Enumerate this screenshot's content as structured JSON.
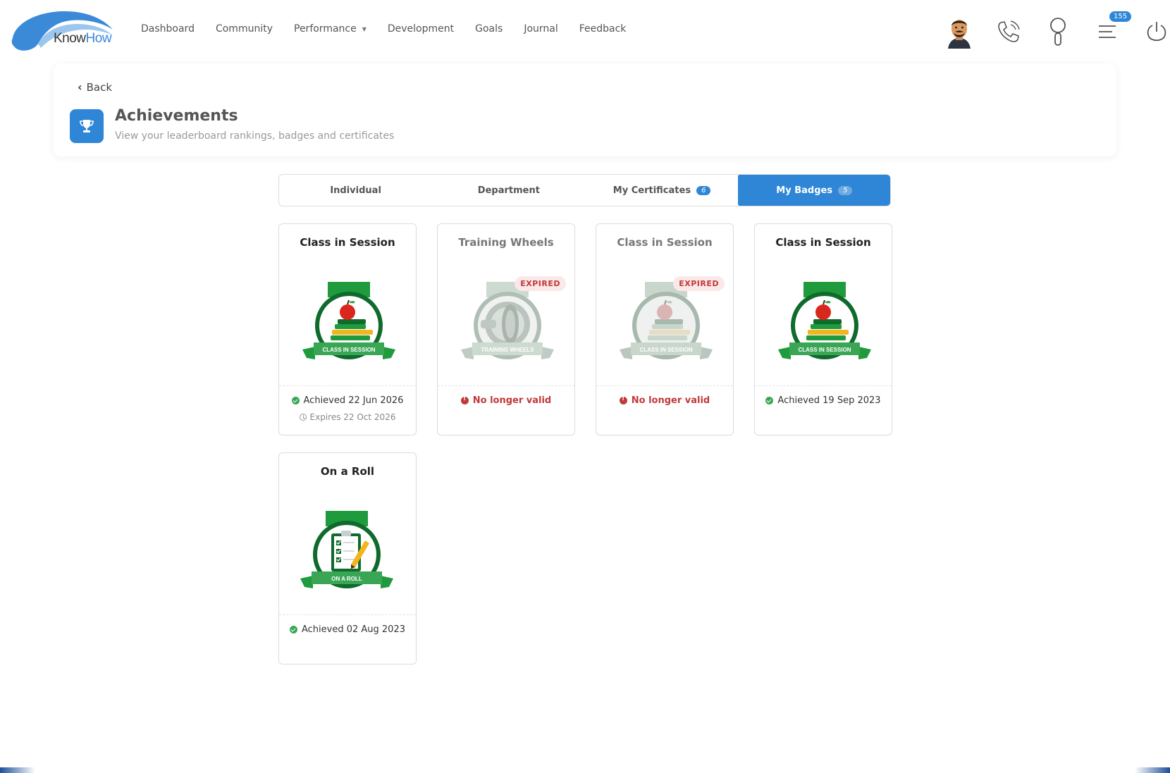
{
  "brand": {
    "name_part1": "Know",
    "name_part2": "How"
  },
  "nav": {
    "links": [
      "Dashboard",
      "Community",
      "Performance",
      "Development",
      "Goals",
      "Journal",
      "Feedback"
    ],
    "notification_count": "155"
  },
  "header": {
    "back_label": "Back",
    "title": "Achievements",
    "subtitle": "View your leaderboard rankings, badges and certificates"
  },
  "tabs": [
    {
      "label": "Individual",
      "count": ""
    },
    {
      "label": "Department",
      "count": ""
    },
    {
      "label": "My Certificates",
      "count": "6"
    },
    {
      "label": "My Badges",
      "count": "5"
    }
  ],
  "active_tab": "My Badges",
  "badges": [
    {
      "title": "Class in Session",
      "banner": "CLASS IN SESSION",
      "status": "Achieved 22 Jun 2026",
      "expires": "Expires 22 Oct 2026",
      "expired_tag": ""
    },
    {
      "title": "Training Wheels",
      "banner": "TRAINING WHEELS",
      "status": "No longer valid",
      "expires": "",
      "expired_tag": "EXPIRED"
    },
    {
      "title": "Class in Session",
      "banner": "CLASS IN SESSION",
      "status": "No longer valid",
      "expires": "",
      "expired_tag": "EXPIRED"
    },
    {
      "title": "Class in Session",
      "banner": "CLASS IN SESSION",
      "status": "Achieved 19 Sep 2023",
      "expires": "",
      "expired_tag": ""
    },
    {
      "title": "On a Roll",
      "banner": "ON A ROLL",
      "status": "Achieved 02 Aug 2023",
      "expires": "",
      "expired_tag": ""
    }
  ],
  "colors": {
    "accent": "#2f86d6",
    "badge_green": "#1f9a3c",
    "badge_dark_green": "#0f6b2c",
    "expired_red": "#c0393b"
  }
}
